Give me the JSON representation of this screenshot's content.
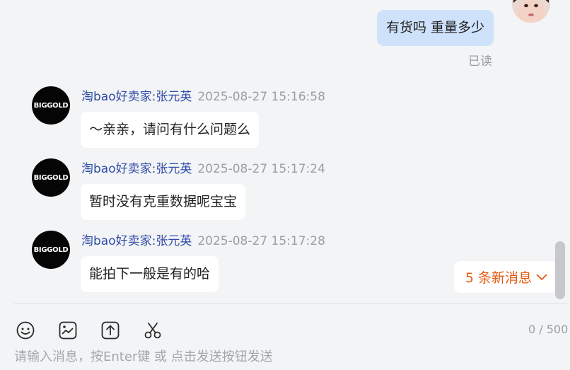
{
  "outgoing": {
    "text": "有货吗 重量多少",
    "status": "已读"
  },
  "messages": [
    {
      "avatar_text": "BIGGOLD",
      "sender": "淘bao好卖家:张元英",
      "time": "2025-08-27 15:16:58",
      "text": "～亲亲，请问有什么问题么"
    },
    {
      "avatar_text": "BIGGOLD",
      "sender": "淘bao好卖家:张元英",
      "time": "2025-08-27 15:17:24",
      "text": "暂时没有克重数据呢宝宝"
    },
    {
      "avatar_text": "BIGGOLD",
      "sender": "淘bao好卖家:张元英",
      "time": "2025-08-27 15:17:28",
      "text": "能拍下一般是有的哈"
    }
  ],
  "new_messages": {
    "label": "5 条新消息"
  },
  "toolbar": {
    "icons": [
      "emoji-icon",
      "image-icon",
      "upload-icon",
      "scissors-icon"
    ],
    "char_count": "0 / 500"
  },
  "input": {
    "value": "",
    "placeholder": "请输入消息，按Enter键 或 点击发送按钮发送"
  },
  "colors": {
    "background": "#f3f4f6",
    "outgoing_bubble": "#cfe2fb",
    "incoming_bubble": "#ffffff",
    "sender": "#2f4aa7",
    "timestamp": "#9a9ea6",
    "new_messages_accent": "#e35a12"
  }
}
